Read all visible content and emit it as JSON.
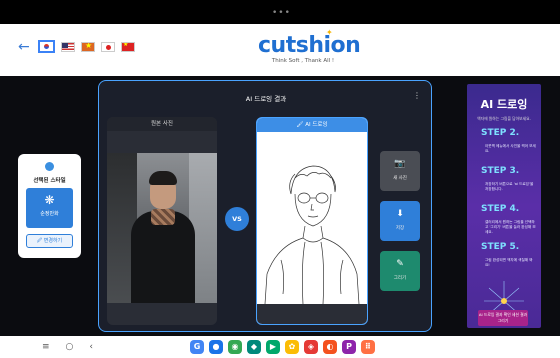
{
  "status_bar": {
    "dots": "•••"
  },
  "header": {
    "back_glyph": "←",
    "languages": [
      {
        "code": "kr",
        "name": "Korean flag",
        "selected": true
      },
      {
        "code": "us",
        "name": "US flag",
        "selected": false
      },
      {
        "code": "vn",
        "name": "Vietnam flag",
        "selected": false
      },
      {
        "code": "jp",
        "name": "Japan flag",
        "selected": false
      },
      {
        "code": "cn",
        "name": "China flag",
        "selected": false
      }
    ],
    "logo": "cutshion",
    "tagline": "Think Soft , Thank All !"
  },
  "style_panel": {
    "label": "선택된 스타일",
    "tile_label": "순정만화",
    "change_label": "🖉 변경하기",
    "accent": "#2f7fd9"
  },
  "result": {
    "title": "AI 드로잉 결과",
    "menu_glyph": "⋮",
    "original_label": "원본 사진",
    "vs_label": "VS",
    "ai_label": "🖌 AI 드로잉",
    "buttons": {
      "new_photo": {
        "icon": "camera-icon",
        "label": "새 사진"
      },
      "save": {
        "icon": "download-icon",
        "label": "저장"
      },
      "draw": {
        "icon": "brush-icon",
        "label": "그리기"
      }
    }
  },
  "ad": {
    "title": "AI 드로잉",
    "subtitle": "액자에 원하는 그림을 담아보세요.",
    "steps": [
      {
        "label": "STEP 2.",
        "desc": "아웃벽 메뉴에서 사진을 찍어 보세요."
      },
      {
        "label": "STEP 3.",
        "desc": "저장하기 버튼으로 'ai 드로잉'을 저장합니다."
      },
      {
        "label": "STEP 4.",
        "desc": "갤러리에서 원하는 그림을 선택하고 '그리기' 버튼을 눌러 완성해 보세요."
      },
      {
        "label": "STEP 5.",
        "desc": "그림 완성되면 액자에 색칠해 봐요!"
      }
    ],
    "cta": "AI 드로잉 결과 확인 세션 결과 그리기"
  },
  "nav": {
    "menu": "≡",
    "home": "○",
    "back": "‹",
    "dock": [
      {
        "name": "google-icon",
        "glyph": "G",
        "color": "#4285f4"
      },
      {
        "name": "messages-icon",
        "glyph": "●",
        "color": "#1a73e8"
      },
      {
        "name": "chrome-icon",
        "glyph": "◉",
        "color": "#34a853"
      },
      {
        "name": "meet-icon",
        "glyph": "◆",
        "color": "#00897b"
      },
      {
        "name": "play-store-icon",
        "glyph": "▶",
        "color": "#00a86b"
      },
      {
        "name": "photos-icon",
        "glyph": "✿",
        "color": "#fbbc05"
      },
      {
        "name": "app-icon-red",
        "glyph": "◈",
        "color": "#e53935"
      },
      {
        "name": "app-icon-colorful",
        "glyph": "◐",
        "color": "#f4511e"
      },
      {
        "name": "app-icon-purple",
        "glyph": "P",
        "color": "#8e24aa"
      },
      {
        "name": "app-drawer-icon",
        "glyph": "⠿",
        "color": "#ff7043"
      }
    ]
  }
}
